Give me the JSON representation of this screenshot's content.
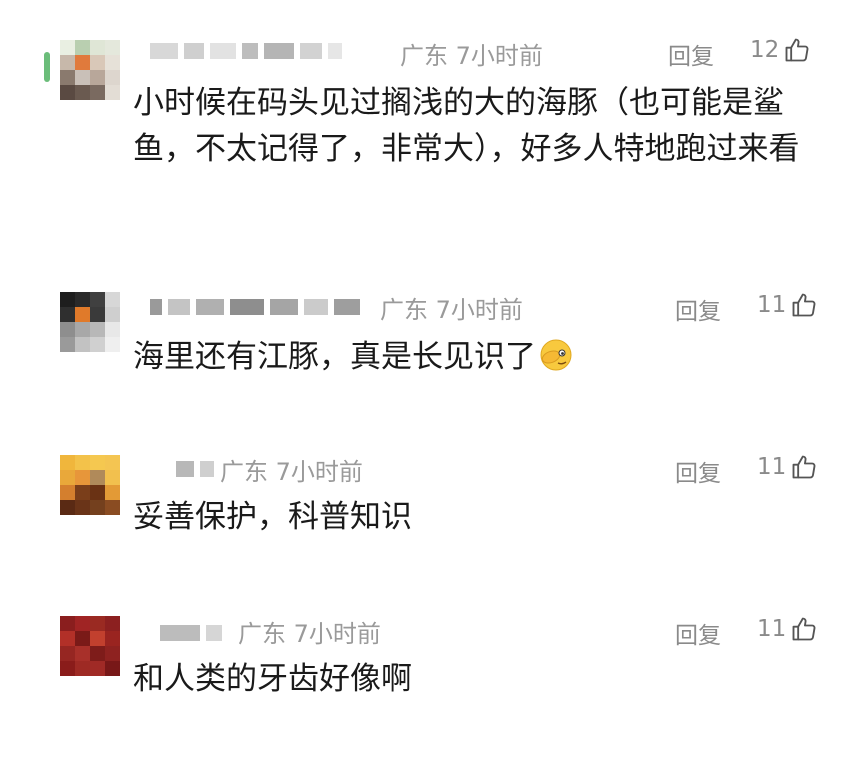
{
  "comments": [
    {
      "location": "广东",
      "time": "7小时前",
      "reply_label": "回复",
      "likes": "12",
      "text": "小时候在码头见过搁浅的大的海豚（也可能是鲨鱼，不太记得了，非常大），好多人特地跑过来看",
      "avatar_colors": [
        "#e9efe2",
        "#b9cfb0",
        "#dfe6d6",
        "#e4e8dc",
        "#c7b8aa",
        "#e07a3c",
        "#d9c8b8",
        "#e6e1d8",
        "#8a7a6e",
        "#c9c0b8",
        "#b8a79a",
        "#ddd6ce",
        "#5a4a42",
        "#6a5a50",
        "#7a6a60",
        "#e3ddd5"
      ]
    },
    {
      "location": "广东",
      "time": "7小时前",
      "reply_label": "回复",
      "likes": "11",
      "text": "海里还有江豚，真是长见识了",
      "avatar_colors": [
        "#1e1e1e",
        "#2a2a2a",
        "#404040",
        "#d7d7d7",
        "#2f2f2f",
        "#e07a2a",
        "#3a3a3a",
        "#cfcfcf",
        "#8e8e8e",
        "#a8a8a8",
        "#b8b8b8",
        "#e8e8e8",
        "#9a9a9a",
        "#c2c2c2",
        "#d0d0d0",
        "#efefef"
      ]
    },
    {
      "location": "广东",
      "time": "7小时前",
      "reply_label": "回复",
      "likes": "11",
      "text": "妥善保护，科普知识",
      "avatar_colors": [
        "#f0b63c",
        "#f3c24a",
        "#f5c850",
        "#f4c552",
        "#e9a83a",
        "#e7963a",
        "#b08a5a",
        "#f2c04e",
        "#d47f2e",
        "#7a3e1a",
        "#6a3214",
        "#e39a36",
        "#5a2a14",
        "#6a3418",
        "#74401e",
        "#8a4c22"
      ]
    },
    {
      "location": "广东",
      "time": "7小时前",
      "reply_label": "回复",
      "likes": "11",
      "text": "和人类的牙齿好像啊",
      "avatar_colors": [
        "#8a1e1e",
        "#a02424",
        "#9a2a22",
        "#8c2020",
        "#b23028",
        "#7a1a18",
        "#c2402e",
        "#9a2420",
        "#962622",
        "#a8302a",
        "#7e1c1a",
        "#8e2220",
        "#8a1c1a",
        "#9e2a24",
        "#a02a26",
        "#781818"
      ]
    }
  ]
}
